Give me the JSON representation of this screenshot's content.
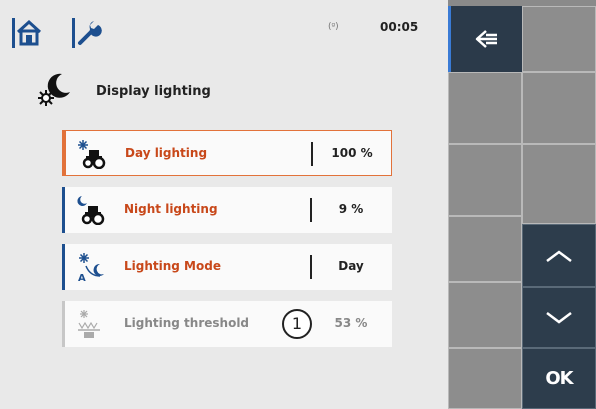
{
  "topbar": {
    "home_icon": "home-icon",
    "settings_icon": "wrench-icon",
    "signal_text": "(ᵍ)",
    "time": "00:05"
  },
  "page": {
    "title": "Display lighting",
    "title_icon": "display-lighting-icon"
  },
  "settings": [
    {
      "label": "Day lighting",
      "value": "100 %",
      "icon": "day-lighting-tractor-icon",
      "state": "selected"
    },
    {
      "label": "Night lighting",
      "value": "9 %",
      "icon": "night-lighting-tractor-icon",
      "state": "normal"
    },
    {
      "label": "Lighting Mode",
      "value": "Day",
      "icon": "lighting-mode-icon",
      "state": "normal"
    },
    {
      "label": "Lighting threshold",
      "value": "53 %",
      "icon": "lighting-threshold-icon",
      "state": "disabled"
    }
  ],
  "callout": "1",
  "softkeys": {
    "back_icon": "back-arrow-icon",
    "up_icon": "chevron-up-icon",
    "down_icon": "chevron-down-icon",
    "ok_label": "OK"
  },
  "colors": {
    "accent_orange": "#e2723a",
    "label_red": "#c8481a",
    "blue_bar": "#1d4f8f",
    "background": "#e9e9e9",
    "softkey_dark": "#2d3d4c"
  }
}
